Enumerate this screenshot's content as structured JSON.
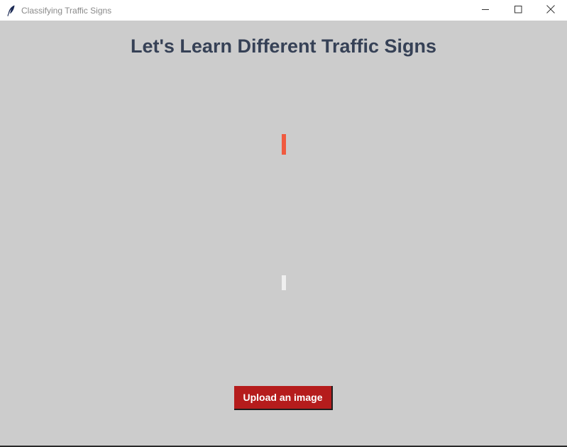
{
  "window": {
    "title": "Classifying Traffic Signs",
    "controls": {
      "minimize_icon": "minimize-icon",
      "maximize_icon": "maximize-icon",
      "close_icon": "close-icon"
    }
  },
  "main": {
    "heading": "Let's Learn Different Traffic Signs",
    "upload_button_label": "Upload an image"
  },
  "colors": {
    "background": "#cccccc",
    "heading": "#364156",
    "button": "#b51c1c",
    "image_placeholder": "#f05a3f",
    "result_label": "#efefef"
  }
}
